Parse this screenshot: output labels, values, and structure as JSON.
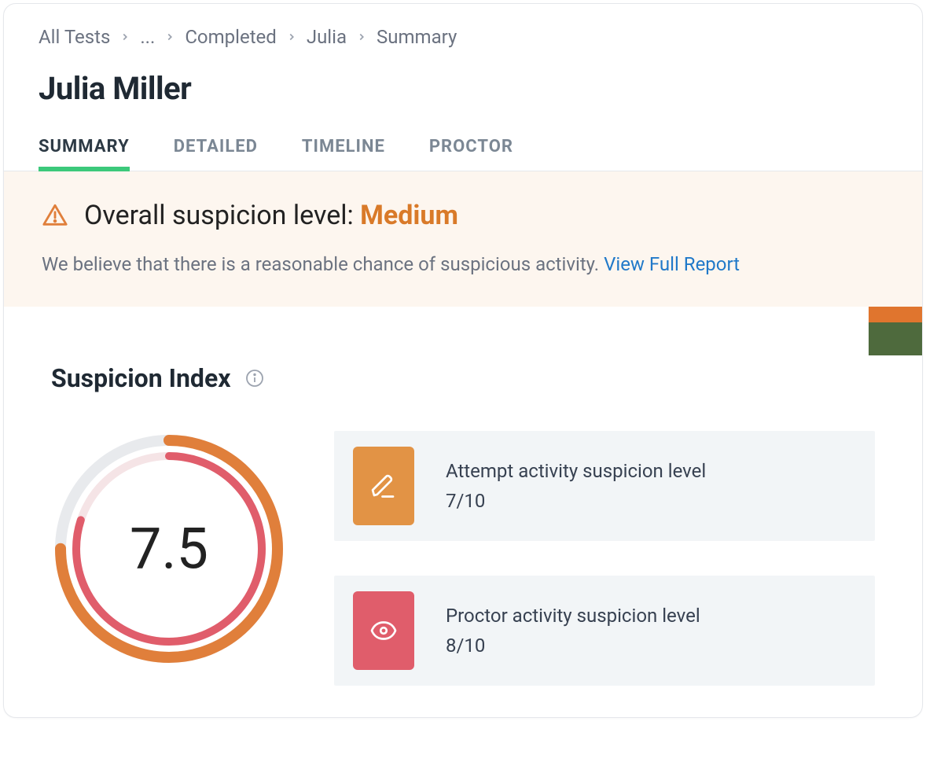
{
  "breadcrumb": {
    "items": [
      "All Tests",
      "...",
      "Completed",
      "Julia",
      "Summary"
    ]
  },
  "page": {
    "title": "Julia Miller"
  },
  "tabs": [
    {
      "label": "SUMMARY",
      "active": true
    },
    {
      "label": "DETAILED",
      "active": false
    },
    {
      "label": "TIMELINE",
      "active": false
    },
    {
      "label": "PROCTOR",
      "active": false
    }
  ],
  "banner": {
    "title_prefix": "Overall suspicion level: ",
    "level": "Medium",
    "description": "We believe that there is a reasonable chance of suspicious activity. ",
    "link_text": "View Full Report",
    "accent_color": "#d97a29"
  },
  "section": {
    "title": "Suspicion Index"
  },
  "gauge": {
    "value": "7.5",
    "outer_fraction": 0.75,
    "inner_fraction": 0.8,
    "outer_color": "#e07f3b",
    "inner_color": "#e05d6b"
  },
  "metrics": [
    {
      "icon": "pencil-icon",
      "color": "orange",
      "label": "Attempt activity suspicion level",
      "score": "7/10"
    },
    {
      "icon": "eye-icon",
      "color": "red",
      "label": "Proctor activity suspicion level",
      "score": "8/10"
    }
  ],
  "chart_data": {
    "type": "pie",
    "title": "Suspicion Index",
    "series": [
      {
        "name": "Attempt activity suspicion level",
        "values": [
          7
        ],
        "max": 10
      },
      {
        "name": "Proctor activity suspicion level",
        "values": [
          8
        ],
        "max": 10
      }
    ],
    "composite_value": 7.5,
    "ylim": [
      0,
      10
    ]
  }
}
